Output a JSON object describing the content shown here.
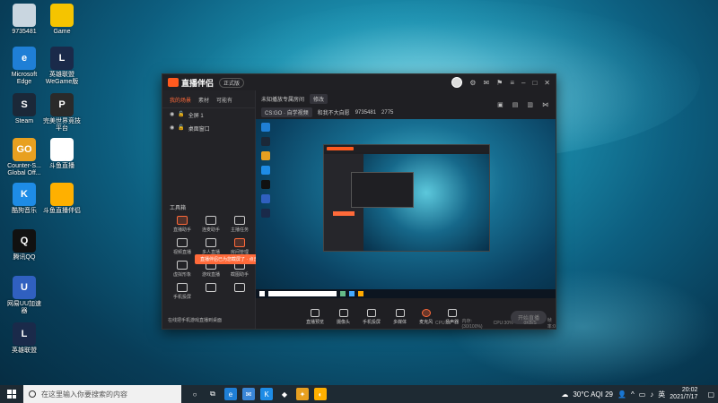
{
  "desktop": {
    "icons": [
      {
        "label": "9735481",
        "color": "#c9d6e0",
        "glyph": "",
        "name": "obs-profile"
      },
      {
        "label": "Game",
        "color": "#f5c400",
        "glyph": "",
        "name": "game"
      },
      {
        "label": "Microsoft Edge",
        "color": "#1f7fd6",
        "glyph": "e",
        "name": "microsoft-edge"
      },
      {
        "label": "英雄联盟 WeGame版",
        "color": "#1a2a4a",
        "glyph": "L",
        "name": "lol-wegame"
      },
      {
        "label": "Steam",
        "color": "#1b2838",
        "glyph": "S",
        "name": "steam"
      },
      {
        "label": "完美世界竞技平台",
        "color": "#2a2a2a",
        "glyph": "P",
        "name": "perfect-world"
      },
      {
        "label": "Counter-S... Global Off...",
        "color": "#e8a020",
        "glyph": "GO",
        "name": "csgo"
      },
      {
        "label": "斗鱼直播",
        "color": "#ffffff",
        "glyph": "",
        "name": "douyu-file"
      },
      {
        "label": "酷狗音乐",
        "color": "#1e8ce6",
        "glyph": "K",
        "name": "kugou"
      },
      {
        "label": "斗鱼直播伴侣",
        "color": "#ffb000",
        "glyph": "",
        "name": "douyu-companion"
      },
      {
        "label": "腾讯QQ",
        "color": "#111111",
        "glyph": "Q",
        "name": "qq"
      },
      {
        "label": "网易UU加速器",
        "color": "#3060c0",
        "glyph": "U",
        "name": "uu-accelerator"
      },
      {
        "label": "英雄联盟",
        "color": "#1a2a4a",
        "glyph": "L",
        "name": "lol"
      }
    ]
  },
  "app": {
    "title": "直播伴侣",
    "version": "正式版",
    "tabs": [
      "我的场景",
      "素材",
      "可能有"
    ],
    "scenes": [
      "全屏 1",
      "桌面窗口"
    ],
    "tools_title": "工具箱",
    "tools": [
      "直播助手",
      "连麦助手",
      "主播任务",
      "视频直播",
      "多人直播",
      "房间管理",
      "虚拟形象",
      "游戏直播",
      "截图助手",
      "手机投屏",
      "",
      ""
    ],
    "toast": "直播伴侣已为您截屏了 · 点击查看完整",
    "banner": "在线把手机游戏直播到桌面",
    "room": {
      "name": "未知播放专属房间",
      "badge": "修改",
      "category": "CS:GO · 自学视频",
      "host": "和我不大自愿",
      "room_id": "9735481",
      "hot": "2775"
    },
    "controls": [
      "直播预览",
      "摄像头",
      "手机投屏",
      "多媒体",
      "麦克风",
      "扬声器"
    ],
    "live_button": "开始直播",
    "status": [
      "CPU:30",
      "内存:(30/100%)",
      "CPU:30%",
      "0KB/S",
      "帧率:0"
    ]
  },
  "taskbar": {
    "search_placeholder": "在这里输入你要搜索的内容",
    "weather": "30°C AQI 29",
    "ime": "英",
    "time": "20:02",
    "date": "2021/7/17"
  }
}
